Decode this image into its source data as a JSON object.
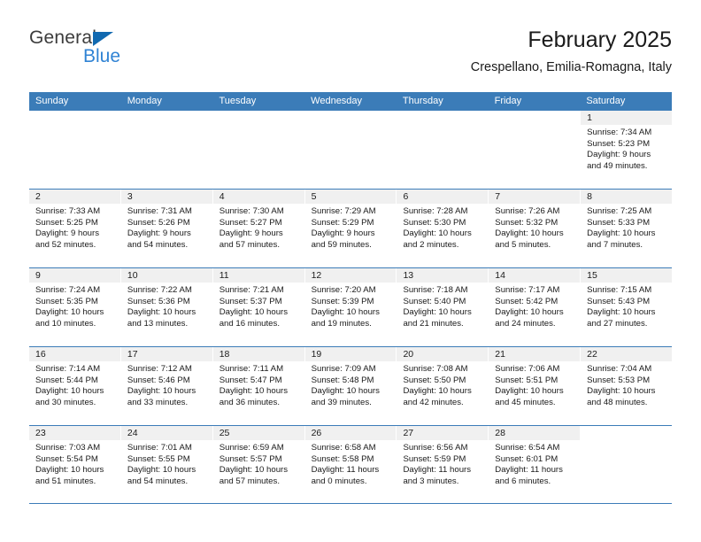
{
  "brand": {
    "name_part1": "General",
    "name_part2": "Blue",
    "triangle_color": "#1169b0",
    "text_color_part2": "#3083d4"
  },
  "header": {
    "title": "February 2025",
    "subtitle": "Crespellano, Emilia-Romagna, Italy"
  },
  "theme": {
    "header_bar_color": "#3b7cb8",
    "day_number_band_color": "#f0f0f0",
    "grid_line_color": "#3b7cb8"
  },
  "weekdays": [
    "Sunday",
    "Monday",
    "Tuesday",
    "Wednesday",
    "Thursday",
    "Friday",
    "Saturday"
  ],
  "weeks": [
    [
      {
        "day": "",
        "blank": true,
        "sunrise": "",
        "sunset": "",
        "daylight1": "",
        "daylight2": ""
      },
      {
        "day": "",
        "blank": true,
        "sunrise": "",
        "sunset": "",
        "daylight1": "",
        "daylight2": ""
      },
      {
        "day": "",
        "blank": true,
        "sunrise": "",
        "sunset": "",
        "daylight1": "",
        "daylight2": ""
      },
      {
        "day": "",
        "blank": true,
        "sunrise": "",
        "sunset": "",
        "daylight1": "",
        "daylight2": ""
      },
      {
        "day": "",
        "blank": true,
        "sunrise": "",
        "sunset": "",
        "daylight1": "",
        "daylight2": ""
      },
      {
        "day": "",
        "blank": true,
        "sunrise": "",
        "sunset": "",
        "daylight1": "",
        "daylight2": ""
      },
      {
        "day": "1",
        "sunrise": "Sunrise: 7:34 AM",
        "sunset": "Sunset: 5:23 PM",
        "daylight1": "Daylight: 9 hours",
        "daylight2": "and 49 minutes."
      }
    ],
    [
      {
        "day": "2",
        "sunrise": "Sunrise: 7:33 AM",
        "sunset": "Sunset: 5:25 PM",
        "daylight1": "Daylight: 9 hours",
        "daylight2": "and 52 minutes."
      },
      {
        "day": "3",
        "sunrise": "Sunrise: 7:31 AM",
        "sunset": "Sunset: 5:26 PM",
        "daylight1": "Daylight: 9 hours",
        "daylight2": "and 54 minutes."
      },
      {
        "day": "4",
        "sunrise": "Sunrise: 7:30 AM",
        "sunset": "Sunset: 5:27 PM",
        "daylight1": "Daylight: 9 hours",
        "daylight2": "and 57 minutes."
      },
      {
        "day": "5",
        "sunrise": "Sunrise: 7:29 AM",
        "sunset": "Sunset: 5:29 PM",
        "daylight1": "Daylight: 9 hours",
        "daylight2": "and 59 minutes."
      },
      {
        "day": "6",
        "sunrise": "Sunrise: 7:28 AM",
        "sunset": "Sunset: 5:30 PM",
        "daylight1": "Daylight: 10 hours",
        "daylight2": "and 2 minutes."
      },
      {
        "day": "7",
        "sunrise": "Sunrise: 7:26 AM",
        "sunset": "Sunset: 5:32 PM",
        "daylight1": "Daylight: 10 hours",
        "daylight2": "and 5 minutes."
      },
      {
        "day": "8",
        "sunrise": "Sunrise: 7:25 AM",
        "sunset": "Sunset: 5:33 PM",
        "daylight1": "Daylight: 10 hours",
        "daylight2": "and 7 minutes."
      }
    ],
    [
      {
        "day": "9",
        "sunrise": "Sunrise: 7:24 AM",
        "sunset": "Sunset: 5:35 PM",
        "daylight1": "Daylight: 10 hours",
        "daylight2": "and 10 minutes."
      },
      {
        "day": "10",
        "sunrise": "Sunrise: 7:22 AM",
        "sunset": "Sunset: 5:36 PM",
        "daylight1": "Daylight: 10 hours",
        "daylight2": "and 13 minutes."
      },
      {
        "day": "11",
        "sunrise": "Sunrise: 7:21 AM",
        "sunset": "Sunset: 5:37 PM",
        "daylight1": "Daylight: 10 hours",
        "daylight2": "and 16 minutes."
      },
      {
        "day": "12",
        "sunrise": "Sunrise: 7:20 AM",
        "sunset": "Sunset: 5:39 PM",
        "daylight1": "Daylight: 10 hours",
        "daylight2": "and 19 minutes."
      },
      {
        "day": "13",
        "sunrise": "Sunrise: 7:18 AM",
        "sunset": "Sunset: 5:40 PM",
        "daylight1": "Daylight: 10 hours",
        "daylight2": "and 21 minutes."
      },
      {
        "day": "14",
        "sunrise": "Sunrise: 7:17 AM",
        "sunset": "Sunset: 5:42 PM",
        "daylight1": "Daylight: 10 hours",
        "daylight2": "and 24 minutes."
      },
      {
        "day": "15",
        "sunrise": "Sunrise: 7:15 AM",
        "sunset": "Sunset: 5:43 PM",
        "daylight1": "Daylight: 10 hours",
        "daylight2": "and 27 minutes."
      }
    ],
    [
      {
        "day": "16",
        "sunrise": "Sunrise: 7:14 AM",
        "sunset": "Sunset: 5:44 PM",
        "daylight1": "Daylight: 10 hours",
        "daylight2": "and 30 minutes."
      },
      {
        "day": "17",
        "sunrise": "Sunrise: 7:12 AM",
        "sunset": "Sunset: 5:46 PM",
        "daylight1": "Daylight: 10 hours",
        "daylight2": "and 33 minutes."
      },
      {
        "day": "18",
        "sunrise": "Sunrise: 7:11 AM",
        "sunset": "Sunset: 5:47 PM",
        "daylight1": "Daylight: 10 hours",
        "daylight2": "and 36 minutes."
      },
      {
        "day": "19",
        "sunrise": "Sunrise: 7:09 AM",
        "sunset": "Sunset: 5:48 PM",
        "daylight1": "Daylight: 10 hours",
        "daylight2": "and 39 minutes."
      },
      {
        "day": "20",
        "sunrise": "Sunrise: 7:08 AM",
        "sunset": "Sunset: 5:50 PM",
        "daylight1": "Daylight: 10 hours",
        "daylight2": "and 42 minutes."
      },
      {
        "day": "21",
        "sunrise": "Sunrise: 7:06 AM",
        "sunset": "Sunset: 5:51 PM",
        "daylight1": "Daylight: 10 hours",
        "daylight2": "and 45 minutes."
      },
      {
        "day": "22",
        "sunrise": "Sunrise: 7:04 AM",
        "sunset": "Sunset: 5:53 PM",
        "daylight1": "Daylight: 10 hours",
        "daylight2": "and 48 minutes."
      }
    ],
    [
      {
        "day": "23",
        "sunrise": "Sunrise: 7:03 AM",
        "sunset": "Sunset: 5:54 PM",
        "daylight1": "Daylight: 10 hours",
        "daylight2": "and 51 minutes."
      },
      {
        "day": "24",
        "sunrise": "Sunrise: 7:01 AM",
        "sunset": "Sunset: 5:55 PM",
        "daylight1": "Daylight: 10 hours",
        "daylight2": "and 54 minutes."
      },
      {
        "day": "25",
        "sunrise": "Sunrise: 6:59 AM",
        "sunset": "Sunset: 5:57 PM",
        "daylight1": "Daylight: 10 hours",
        "daylight2": "and 57 minutes."
      },
      {
        "day": "26",
        "sunrise": "Sunrise: 6:58 AM",
        "sunset": "Sunset: 5:58 PM",
        "daylight1": "Daylight: 11 hours",
        "daylight2": "and 0 minutes."
      },
      {
        "day": "27",
        "sunrise": "Sunrise: 6:56 AM",
        "sunset": "Sunset: 5:59 PM",
        "daylight1": "Daylight: 11 hours",
        "daylight2": "and 3 minutes."
      },
      {
        "day": "28",
        "sunrise": "Sunrise: 6:54 AM",
        "sunset": "Sunset: 6:01 PM",
        "daylight1": "Daylight: 11 hours",
        "daylight2": "and 6 minutes."
      },
      {
        "day": "",
        "blank": true,
        "sunrise": "",
        "sunset": "",
        "daylight1": "",
        "daylight2": ""
      }
    ]
  ]
}
